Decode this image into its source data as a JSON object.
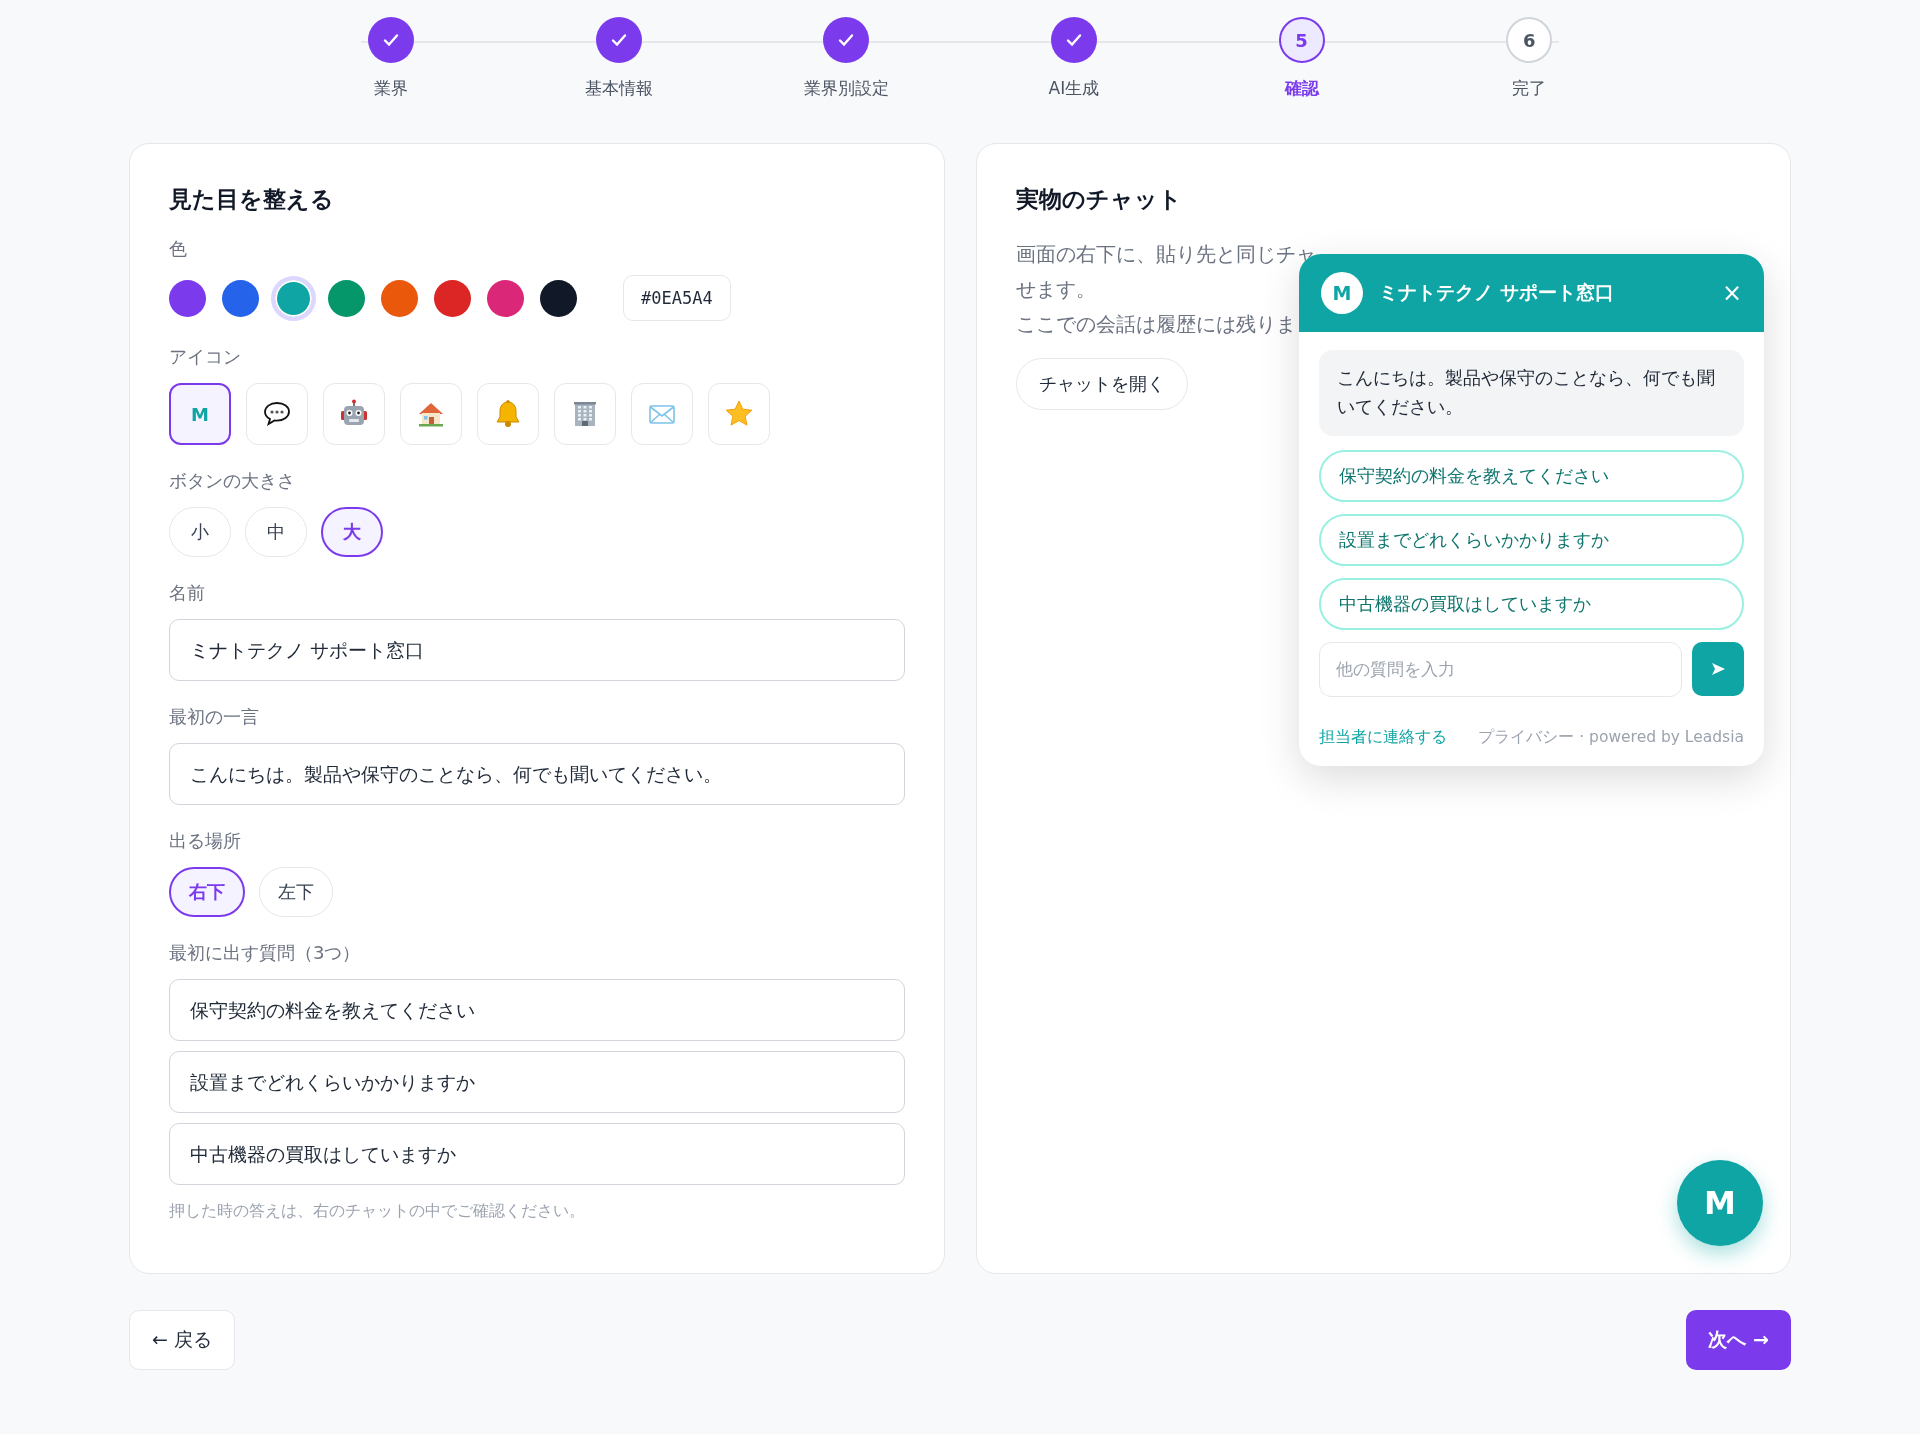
{
  "stepper": {
    "steps": [
      {
        "label": "業界",
        "completed": true,
        "current": false
      },
      {
        "label": "基本情報",
        "completed": true,
        "current": false
      },
      {
        "label": "業界別設定",
        "completed": true,
        "current": false
      },
      {
        "label": "AI生成",
        "completed": true,
        "current": false
      },
      {
        "label": "確認",
        "completed": false,
        "current": true,
        "number": "5"
      },
      {
        "label": "完了",
        "completed": false,
        "current": false,
        "number": "6"
      }
    ]
  },
  "appearance": {
    "title": "見た目を整える",
    "colors": {
      "label": "色",
      "swatches": [
        {
          "color": "#7c3aed",
          "selected": false
        },
        {
          "color": "#2563eb",
          "selected": false
        },
        {
          "color": "#0ea5a4",
          "selected": true
        },
        {
          "color": "#059669",
          "selected": false
        },
        {
          "color": "#ea580c",
          "selected": false
        },
        {
          "color": "#dc2626",
          "selected": false
        },
        {
          "color": "#db2777",
          "selected": false
        },
        {
          "color": "#111827",
          "selected": false
        }
      ],
      "hex_value": "#0EA5A4"
    },
    "icons": {
      "label": "アイコン",
      "options": [
        {
          "kind": "letter",
          "text": "M",
          "selected": true
        },
        {
          "kind": "speech-bubble",
          "selected": false
        },
        {
          "kind": "robot",
          "selected": false
        },
        {
          "kind": "house",
          "selected": false
        },
        {
          "kind": "bell",
          "selected": false
        },
        {
          "kind": "building",
          "selected": false
        },
        {
          "kind": "envelope",
          "selected": false
        },
        {
          "kind": "star",
          "selected": false
        }
      ]
    },
    "button_size": {
      "label": "ボタンの大きさ",
      "options": [
        {
          "label": "小",
          "selected": false
        },
        {
          "label": "中",
          "selected": false
        },
        {
          "label": "大",
          "selected": true
        }
      ]
    },
    "name": {
      "label": "名前",
      "value": "ミナトテクノ サポート窓口"
    },
    "greeting": {
      "label": "最初の一言",
      "value": "こんにちは。製品や保守のことなら、何でも聞いてください。"
    },
    "position": {
      "label": "出る場所",
      "options": [
        {
          "label": "右下",
          "selected": true
        },
        {
          "label": "左下",
          "selected": false
        }
      ]
    },
    "questions": {
      "label": "最初に出す質問（3つ）",
      "values": [
        "保守契約の料金を教えてください",
        "設置までどれくらいかかりますか",
        "中古機器の買取はしていますか"
      ],
      "hint": "押した時の答えは、右のチャットの中でご確認ください。"
    }
  },
  "preview": {
    "title": "実物のチャット",
    "description": [
      "画面の右下に、貼り先と同じチャ",
      "せます。"
    ],
    "note": "ここでの会話は履歴には残りま",
    "open_button": "チャットを開く",
    "chat": {
      "avatar": "M",
      "title": "ミナトテクノ サポート窓口",
      "close": "×",
      "greeting": "こんにちは。製品や保守のことなら、何でも聞いてください。",
      "suggestions": [
        "保守契約の料金を教えてください",
        "設置までどれくらいかかりますか",
        "中古機器の買取はしていますか"
      ],
      "input_placeholder": "他の質問を入力",
      "contact_link": "担当者に連絡する",
      "footer": "プライバシー · powered by Leadsia"
    },
    "launcher": "M"
  },
  "navigation": {
    "back": "← 戻る",
    "next": "次へ →"
  }
}
